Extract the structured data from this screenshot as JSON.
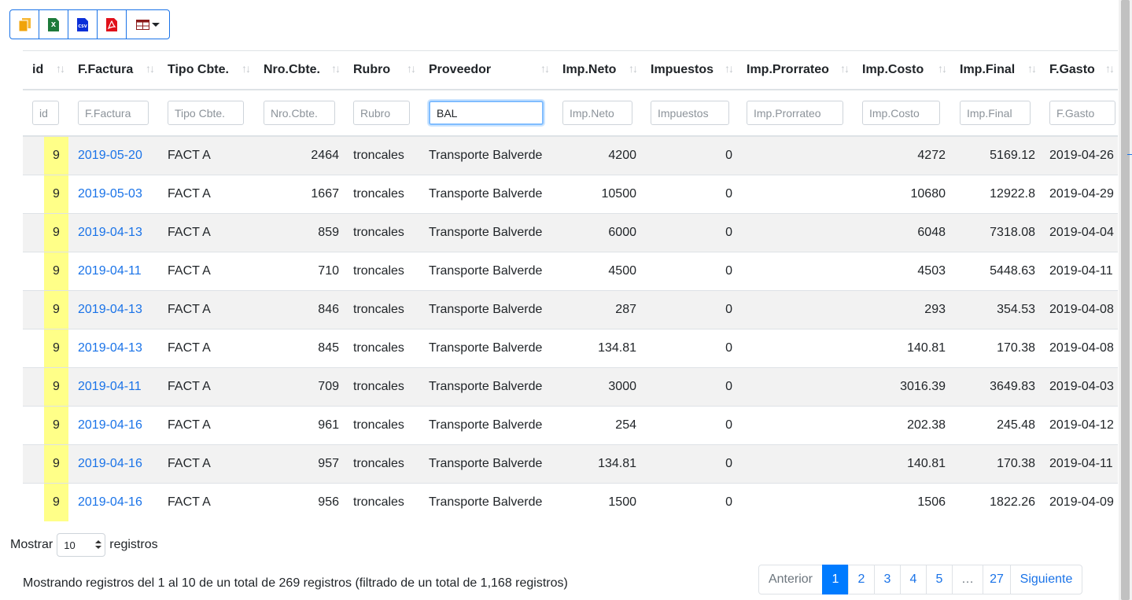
{
  "toolbar": {
    "buttons": [
      {
        "icon": "copy-icon",
        "color": "#f0a30a"
      },
      {
        "icon": "excel-icon",
        "color": "#1d7a3a",
        "label": "X"
      },
      {
        "icon": "csv-icon",
        "color": "#0a2fd8",
        "label": "CSV"
      },
      {
        "icon": "pdf-icon",
        "color": "#e0101a"
      },
      {
        "icon": "table-columns-icon",
        "color": "#8b1a1a"
      }
    ]
  },
  "table": {
    "headers": [
      "id",
      "F.Factura",
      "Tipo Cbte.",
      "Nro.Cbte.",
      "Rubro",
      "Proveedor",
      "Imp.Neto",
      "Impuestos",
      "Imp.Prorrateo",
      "Imp.Costo",
      "Imp.Final",
      "F.Gasto"
    ],
    "sort_glyph": "↑↓",
    "filters": [
      {
        "placeholder": "id",
        "value": ""
      },
      {
        "placeholder": "F.Factura",
        "value": ""
      },
      {
        "placeholder": "Tipo Cbte.",
        "value": ""
      },
      {
        "placeholder": "Nro.Cbte.",
        "value": ""
      },
      {
        "placeholder": "Rubro",
        "value": ""
      },
      {
        "placeholder": "Proveedor",
        "value": "BAL"
      },
      {
        "placeholder": "Imp.Neto",
        "value": ""
      },
      {
        "placeholder": "Impuestos",
        "value": ""
      },
      {
        "placeholder": "Imp.Prorrateo",
        "value": ""
      },
      {
        "placeholder": "Imp.Costo",
        "value": ""
      },
      {
        "placeholder": "Imp.Final",
        "value": ""
      },
      {
        "placeholder": "F.Gasto",
        "value": ""
      }
    ],
    "rows": [
      [
        "9",
        "2019-05-20",
        "FACT A",
        "2464",
        "troncales",
        "Transporte Balverde",
        "4200",
        "0",
        "",
        "4272",
        "5169.12",
        "2019-04-26"
      ],
      [
        "9",
        "2019-05-03",
        "FACT A",
        "1667",
        "troncales",
        "Transporte Balverde",
        "10500",
        "0",
        "",
        "10680",
        "12922.8",
        "2019-04-29"
      ],
      [
        "9",
        "2019-04-13",
        "FACT A",
        "859",
        "troncales",
        "Transporte Balverde",
        "6000",
        "0",
        "",
        "6048",
        "7318.08",
        "2019-04-04"
      ],
      [
        "9",
        "2019-04-11",
        "FACT A",
        "710",
        "troncales",
        "Transporte Balverde",
        "4500",
        "0",
        "",
        "4503",
        "5448.63",
        "2019-04-11"
      ],
      [
        "9",
        "2019-04-13",
        "FACT A",
        "846",
        "troncales",
        "Transporte Balverde",
        "287",
        "0",
        "",
        "293",
        "354.53",
        "2019-04-08"
      ],
      [
        "9",
        "2019-04-13",
        "FACT A",
        "845",
        "troncales",
        "Transporte Balverde",
        "134.81",
        "0",
        "",
        "140.81",
        "170.38",
        "2019-04-08"
      ],
      [
        "9",
        "2019-04-11",
        "FACT A",
        "709",
        "troncales",
        "Transporte Balverde",
        "3000",
        "0",
        "",
        "3016.39",
        "3649.83",
        "2019-04-03"
      ],
      [
        "9",
        "2019-04-16",
        "FACT A",
        "961",
        "troncales",
        "Transporte Balverde",
        "254",
        "0",
        "",
        "202.38",
        "245.48",
        "2019-04-12"
      ],
      [
        "9",
        "2019-04-16",
        "FACT A",
        "957",
        "troncales",
        "Transporte Balverde",
        "134.81",
        "0",
        "",
        "140.81",
        "170.38",
        "2019-04-11"
      ],
      [
        "9",
        "2019-04-16",
        "FACT A",
        "956",
        "troncales",
        "Transporte Balverde",
        "1500",
        "0",
        "",
        "1506",
        "1822.26",
        "2019-04-09"
      ]
    ]
  },
  "length": {
    "prefix": "Mostrar",
    "value": "10",
    "suffix": "registros"
  },
  "info": "Mostrando registros del 1 al 10 de un total de 269 registros (filtrado de un total de 1,168 registros)",
  "pagination": {
    "items": [
      {
        "label": "Anterior",
        "state": "disabled"
      },
      {
        "label": "1",
        "state": "active"
      },
      {
        "label": "2",
        "state": ""
      },
      {
        "label": "3",
        "state": ""
      },
      {
        "label": "4",
        "state": ""
      },
      {
        "label": "5",
        "state": ""
      },
      {
        "label": "…",
        "state": "disabled"
      },
      {
        "label": "27",
        "state": ""
      },
      {
        "label": "Siguiente",
        "state": ""
      }
    ]
  },
  "colors": {
    "accent": "#007bff",
    "link": "#1a73e8",
    "id_highlight": "#ffff88",
    "stripe": "#f2f2f2"
  }
}
